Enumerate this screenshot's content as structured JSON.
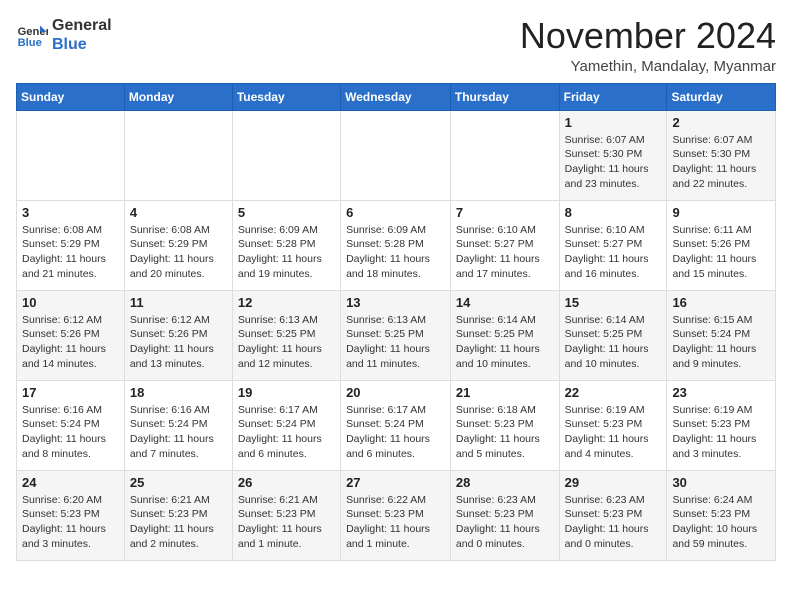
{
  "header": {
    "logo_line1": "General",
    "logo_line2": "Blue",
    "month_year": "November 2024",
    "location": "Yamethin, Mandalay, Myanmar"
  },
  "days_of_week": [
    "Sunday",
    "Monday",
    "Tuesday",
    "Wednesday",
    "Thursday",
    "Friday",
    "Saturday"
  ],
  "weeks": [
    [
      {
        "day": "",
        "info": ""
      },
      {
        "day": "",
        "info": ""
      },
      {
        "day": "",
        "info": ""
      },
      {
        "day": "",
        "info": ""
      },
      {
        "day": "",
        "info": ""
      },
      {
        "day": "1",
        "info": "Sunrise: 6:07 AM\nSunset: 5:30 PM\nDaylight: 11 hours and 23 minutes."
      },
      {
        "day": "2",
        "info": "Sunrise: 6:07 AM\nSunset: 5:30 PM\nDaylight: 11 hours and 22 minutes."
      }
    ],
    [
      {
        "day": "3",
        "info": "Sunrise: 6:08 AM\nSunset: 5:29 PM\nDaylight: 11 hours and 21 minutes."
      },
      {
        "day": "4",
        "info": "Sunrise: 6:08 AM\nSunset: 5:29 PM\nDaylight: 11 hours and 20 minutes."
      },
      {
        "day": "5",
        "info": "Sunrise: 6:09 AM\nSunset: 5:28 PM\nDaylight: 11 hours and 19 minutes."
      },
      {
        "day": "6",
        "info": "Sunrise: 6:09 AM\nSunset: 5:28 PM\nDaylight: 11 hours and 18 minutes."
      },
      {
        "day": "7",
        "info": "Sunrise: 6:10 AM\nSunset: 5:27 PM\nDaylight: 11 hours and 17 minutes."
      },
      {
        "day": "8",
        "info": "Sunrise: 6:10 AM\nSunset: 5:27 PM\nDaylight: 11 hours and 16 minutes."
      },
      {
        "day": "9",
        "info": "Sunrise: 6:11 AM\nSunset: 5:26 PM\nDaylight: 11 hours and 15 minutes."
      }
    ],
    [
      {
        "day": "10",
        "info": "Sunrise: 6:12 AM\nSunset: 5:26 PM\nDaylight: 11 hours and 14 minutes."
      },
      {
        "day": "11",
        "info": "Sunrise: 6:12 AM\nSunset: 5:26 PM\nDaylight: 11 hours and 13 minutes."
      },
      {
        "day": "12",
        "info": "Sunrise: 6:13 AM\nSunset: 5:25 PM\nDaylight: 11 hours and 12 minutes."
      },
      {
        "day": "13",
        "info": "Sunrise: 6:13 AM\nSunset: 5:25 PM\nDaylight: 11 hours and 11 minutes."
      },
      {
        "day": "14",
        "info": "Sunrise: 6:14 AM\nSunset: 5:25 PM\nDaylight: 11 hours and 10 minutes."
      },
      {
        "day": "15",
        "info": "Sunrise: 6:14 AM\nSunset: 5:25 PM\nDaylight: 11 hours and 10 minutes."
      },
      {
        "day": "16",
        "info": "Sunrise: 6:15 AM\nSunset: 5:24 PM\nDaylight: 11 hours and 9 minutes."
      }
    ],
    [
      {
        "day": "17",
        "info": "Sunrise: 6:16 AM\nSunset: 5:24 PM\nDaylight: 11 hours and 8 minutes."
      },
      {
        "day": "18",
        "info": "Sunrise: 6:16 AM\nSunset: 5:24 PM\nDaylight: 11 hours and 7 minutes."
      },
      {
        "day": "19",
        "info": "Sunrise: 6:17 AM\nSunset: 5:24 PM\nDaylight: 11 hours and 6 minutes."
      },
      {
        "day": "20",
        "info": "Sunrise: 6:17 AM\nSunset: 5:24 PM\nDaylight: 11 hours and 6 minutes."
      },
      {
        "day": "21",
        "info": "Sunrise: 6:18 AM\nSunset: 5:23 PM\nDaylight: 11 hours and 5 minutes."
      },
      {
        "day": "22",
        "info": "Sunrise: 6:19 AM\nSunset: 5:23 PM\nDaylight: 11 hours and 4 minutes."
      },
      {
        "day": "23",
        "info": "Sunrise: 6:19 AM\nSunset: 5:23 PM\nDaylight: 11 hours and 3 minutes."
      }
    ],
    [
      {
        "day": "24",
        "info": "Sunrise: 6:20 AM\nSunset: 5:23 PM\nDaylight: 11 hours and 3 minutes."
      },
      {
        "day": "25",
        "info": "Sunrise: 6:21 AM\nSunset: 5:23 PM\nDaylight: 11 hours and 2 minutes."
      },
      {
        "day": "26",
        "info": "Sunrise: 6:21 AM\nSunset: 5:23 PM\nDaylight: 11 hours and 1 minute."
      },
      {
        "day": "27",
        "info": "Sunrise: 6:22 AM\nSunset: 5:23 PM\nDaylight: 11 hours and 1 minute."
      },
      {
        "day": "28",
        "info": "Sunrise: 6:23 AM\nSunset: 5:23 PM\nDaylight: 11 hours and 0 minutes."
      },
      {
        "day": "29",
        "info": "Sunrise: 6:23 AM\nSunset: 5:23 PM\nDaylight: 11 hours and 0 minutes."
      },
      {
        "day": "30",
        "info": "Sunrise: 6:24 AM\nSunset: 5:23 PM\nDaylight: 10 hours and 59 minutes."
      }
    ]
  ]
}
